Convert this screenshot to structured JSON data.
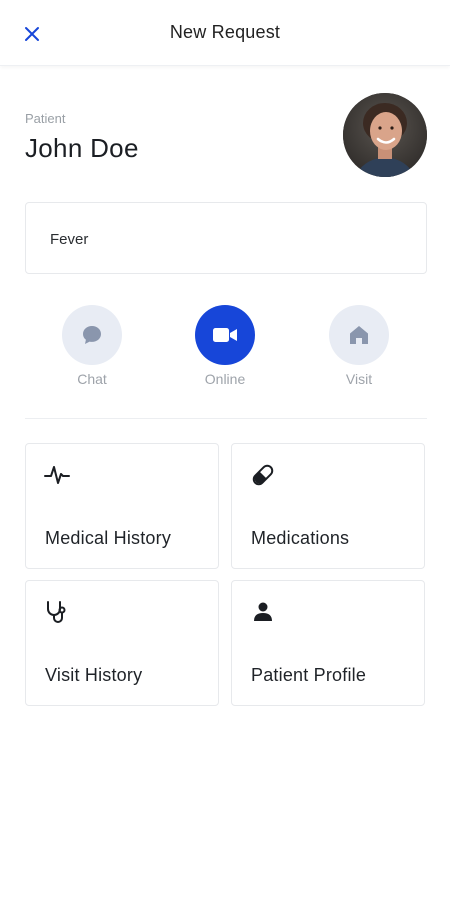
{
  "header": {
    "title": "New Request",
    "close_icon": "close-icon"
  },
  "patient": {
    "label": "Patient",
    "name": "John Doe"
  },
  "reason": {
    "value": "Fever"
  },
  "modes": [
    {
      "label": "Chat",
      "icon": "chat-bubble-icon",
      "active": false
    },
    {
      "label": "Online",
      "icon": "video-camera-icon",
      "active": true
    },
    {
      "label": "Visit",
      "icon": "home-icon",
      "active": false
    }
  ],
  "cards": [
    {
      "label": "Medical History",
      "icon": "pulse-icon"
    },
    {
      "label": "Medications",
      "icon": "pill-icon"
    },
    {
      "label": "Visit History",
      "icon": "stethoscope-icon"
    },
    {
      "label": "Patient Profile",
      "icon": "person-icon"
    }
  ],
  "colors": {
    "accent": "#1746d9",
    "inactive_mode_bg": "#e8ecf4",
    "inactive_mode_icon": "#8a96ad",
    "muted_text": "#9ea3aa"
  }
}
